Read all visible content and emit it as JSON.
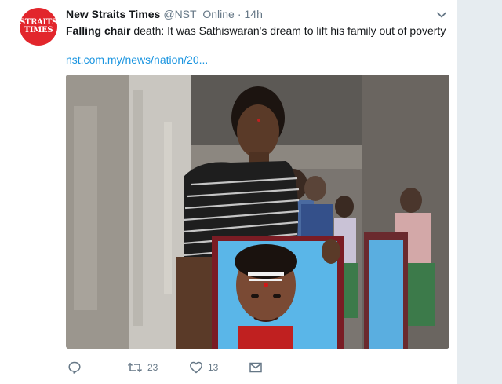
{
  "tweet": {
    "avatar": {
      "line1": "STRAITS",
      "line2": "TIMES",
      "bg": "#e2262c"
    },
    "display_name": "New Straits Times",
    "handle": "@NST_Online",
    "separator": "·",
    "time": "14h",
    "text_bold": "Falling chair",
    "text_rest": " death: It was Sathiswaran's dream to lift his family out of poverty",
    "link": "nst.com.my/news/nation/20...",
    "media": {
      "icon": "photo",
      "content": "woman holding framed portrait of a boy"
    },
    "actions": {
      "reply": {
        "icon": "reply-icon"
      },
      "retweet": {
        "icon": "retweet-icon",
        "count": "23"
      },
      "like": {
        "icon": "heart-icon",
        "count": "13"
      },
      "dm": {
        "icon": "envelope-icon"
      }
    }
  },
  "colors": {
    "link": "#1b95e0",
    "text": "#14171a",
    "muted": "#657786",
    "background": "#e6ecf0"
  }
}
